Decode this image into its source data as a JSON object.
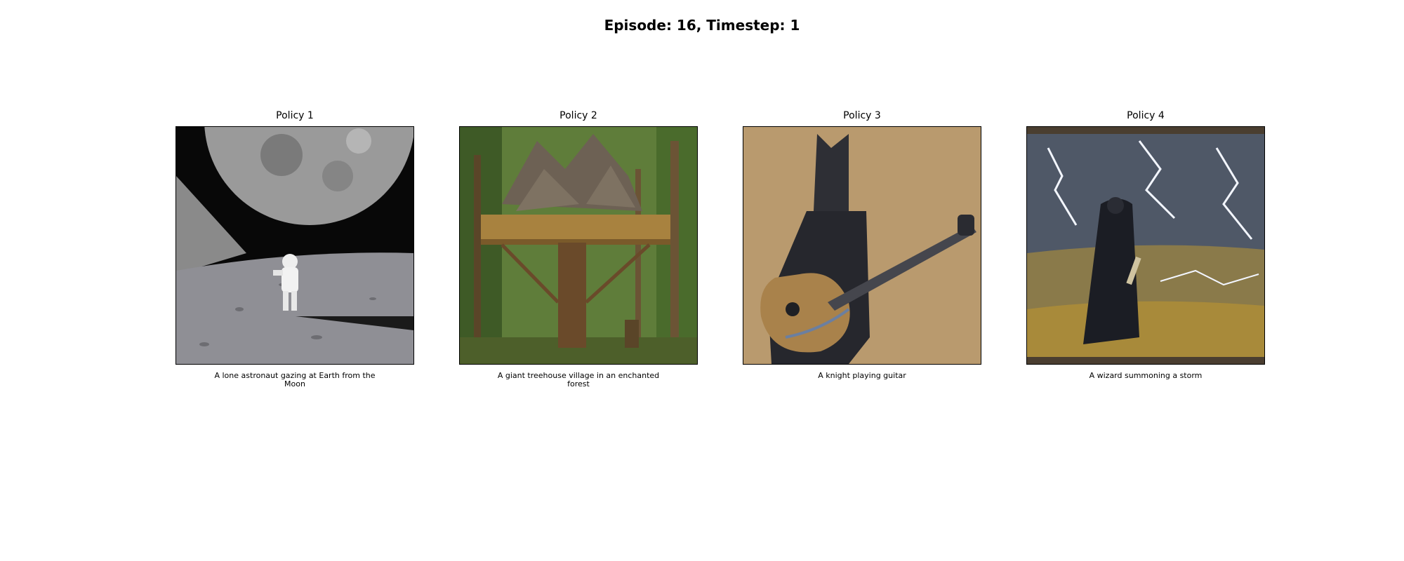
{
  "figure": {
    "title": "Episode: 16, Timestep: 1"
  },
  "panels": [
    {
      "title": "Policy 1",
      "caption": "A lone astronaut gazing at Earth from the Moon",
      "image_icon": "astronaut-on-moon-image"
    },
    {
      "title": "Policy 2",
      "caption": "A giant treehouse village in an enchanted forest",
      "image_icon": "treehouse-forest-image"
    },
    {
      "title": "Policy 3",
      "caption": "A knight playing guitar",
      "image_icon": "knight-guitar-image"
    },
    {
      "title": "Policy 4",
      "caption": "A wizard summoning a storm",
      "image_icon": "wizard-storm-image"
    }
  ]
}
